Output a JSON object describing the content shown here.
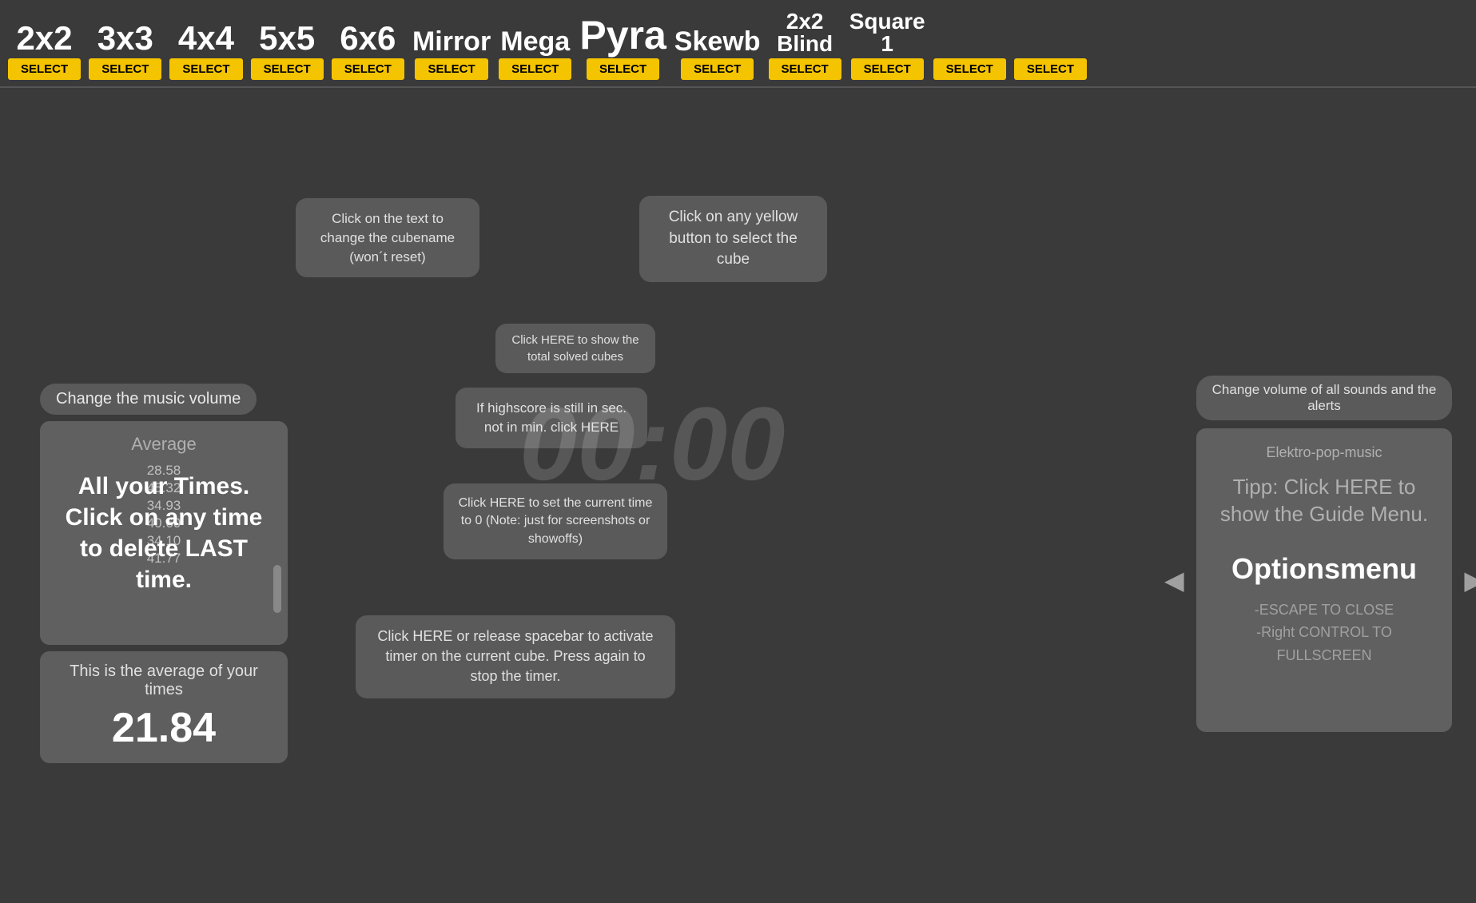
{
  "nav": {
    "items": [
      {
        "label": "2x2",
        "select": "SELECT"
      },
      {
        "label": "3x3",
        "select": "SELECT"
      },
      {
        "label": "4x4",
        "select": "SELECT"
      },
      {
        "label": "5x5",
        "select": "SELECT"
      },
      {
        "label": "6x6",
        "select": "SELECT"
      },
      {
        "label": "Mirror",
        "select": "SELECT"
      },
      {
        "label": "Mega",
        "select": "SELECT"
      },
      {
        "label": "Pyra",
        "select": "SELECT"
      },
      {
        "label": "Skewb",
        "select": "SELECT"
      },
      {
        "label": "2x2\nBlind",
        "select": "SELECT",
        "small": true
      },
      {
        "label": "Square\n1",
        "select": "SELECT",
        "small": true
      },
      {
        "label": "",
        "select": "SELECT"
      },
      {
        "label": "",
        "select": "SELECT"
      }
    ]
  },
  "tooltips": {
    "cubename": "Click on the text to change the cubename (won´t reset)",
    "select_cube": "Click on any yellow button to select the cube",
    "total_solved": "Click HERE to show the total solved cubes",
    "highscore": "If highscore is still in sec. not in min. click HERE",
    "set_zero": "Click HERE to set the current time to 0 (Note: just for screenshots or showoffs)",
    "timer": "Click HERE or release spacebar to activate timer on the current cube. Press again to stop the timer."
  },
  "left": {
    "music_volume_label": "Change the music volume",
    "times_header": "Average",
    "times": [
      "28.58",
      "45.32",
      "34.93",
      "40.60",
      "34.10",
      "41.77"
    ],
    "times_main_text": "All your Times. Click on any time to delete LAST time.",
    "average_title": "This is the average of your times",
    "average_value": "21.84"
  },
  "center": {
    "timer_display": "00:00"
  },
  "right": {
    "change_volume_label": "Change volume of all sounds and the alerts",
    "music_name": "Elektro-pop-music",
    "tipp_text": "Tipp: Click HERE to show the Guide Menu.",
    "options_title": "Optionsmenu",
    "shortcuts": "-ESCAPE TO CLOSE\n-Right CONTROL TO FULLSCREEN"
  }
}
